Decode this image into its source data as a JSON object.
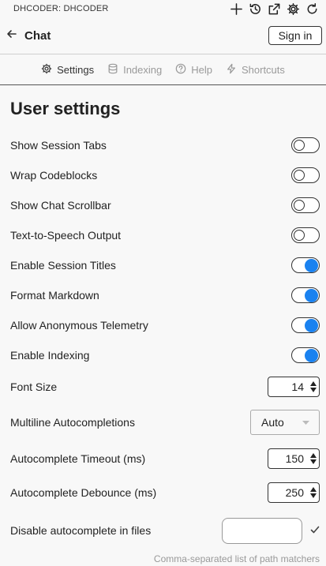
{
  "topbar": {
    "title": "DHCODER: DHCODER",
    "icons": [
      "plus-icon",
      "history-icon",
      "open-external-icon",
      "gear-icon",
      "refresh-icon"
    ]
  },
  "chatbar": {
    "back_icon": "arrow-left-icon",
    "title": "Chat",
    "signin_label": "Sign in"
  },
  "tabs": [
    {
      "label": "Settings",
      "icon": "gear-icon",
      "active": true
    },
    {
      "label": "Indexing",
      "icon": "database-icon",
      "active": false
    },
    {
      "label": "Help",
      "icon": "help-circle-icon",
      "active": false
    },
    {
      "label": "Shortcuts",
      "icon": "bolt-icon",
      "active": false
    }
  ],
  "settings": {
    "heading": "User settings",
    "toggles": [
      {
        "label": "Show Session Tabs",
        "on": false
      },
      {
        "label": "Wrap Codeblocks",
        "on": false
      },
      {
        "label": "Show Chat Scrollbar",
        "on": false
      },
      {
        "label": "Text-to-Speech Output",
        "on": false
      },
      {
        "label": "Enable Session Titles",
        "on": true
      },
      {
        "label": "Format Markdown",
        "on": true
      },
      {
        "label": "Allow Anonymous Telemetry",
        "on": true
      },
      {
        "label": "Enable Indexing",
        "on": true
      }
    ],
    "font_size": {
      "label": "Font Size",
      "value": "14"
    },
    "multiline": {
      "label": "Multiline Autocompletions",
      "value": "Auto"
    },
    "timeout": {
      "label": "Autocomplete Timeout (ms)",
      "value": "150"
    },
    "debounce": {
      "label": "Autocomplete Debounce (ms)",
      "value": "250"
    },
    "disable_files": {
      "label": "Disable autocomplete in files",
      "value": "",
      "hint": "Comma-separated list of path matchers"
    }
  },
  "colors": {
    "accent": "#1a82f0",
    "background": "#f8f8f8",
    "muted_text": "#9a9a9a"
  }
}
